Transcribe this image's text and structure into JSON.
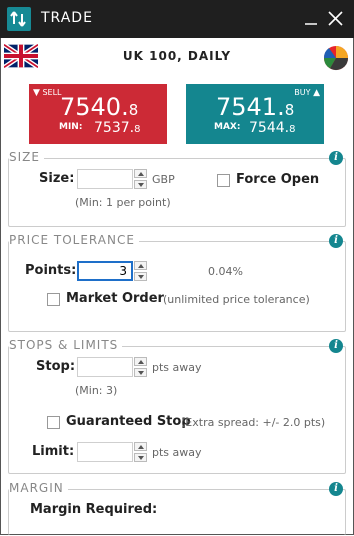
{
  "window": {
    "title": "TRADE",
    "app_icon": "trade-app-icon",
    "minimize_icon": "minimize-icon",
    "close_icon": "close-icon"
  },
  "header": {
    "market_name": "UK 100, DAILY",
    "flag_icon": "uk-flag-icon",
    "sentiment_icon": "pie-chart-icon"
  },
  "sell": {
    "label": "SELL",
    "price_main": "7540.",
    "price_small": "8",
    "min_label": "MIN:",
    "min_main": "7537.",
    "min_small": "8",
    "color": "#cc2a36"
  },
  "buy": {
    "label": "BUY",
    "price_main": "7541.",
    "price_small": "8",
    "max_label": "MAX:",
    "max_main": "7544.",
    "max_small": "8",
    "color": "#14868f"
  },
  "size": {
    "legend": "SIZE",
    "label": "Size:",
    "value": "",
    "unit": "GBP",
    "force_open_label": "Force Open",
    "force_open_checked": false,
    "hint": "(Min: 1 per point)"
  },
  "price_tolerance": {
    "legend": "PRICE TOLERANCE",
    "points_label": "Points:",
    "points_value": "3",
    "percent": "0.04%",
    "market_order_label": "Market Order",
    "market_order_checked": false,
    "market_order_hint": "(unlimited price tolerance)"
  },
  "stops_limits": {
    "legend": "STOPS & LIMITS",
    "stop_label": "Stop:",
    "stop_value": "",
    "stop_unit": "pts away",
    "stop_hint": "(Min: 3)",
    "guaranteed_label": "Guaranteed Stop",
    "guaranteed_checked": false,
    "guaranteed_hint": "(Extra spread: +/- 2.0 pts)",
    "limit_label": "Limit:",
    "limit_value": "",
    "limit_unit": "pts away"
  },
  "margin": {
    "legend": "MARGIN",
    "required_label": "Margin Required:"
  },
  "info_icon": "info-icon",
  "info_glyph": "i"
}
